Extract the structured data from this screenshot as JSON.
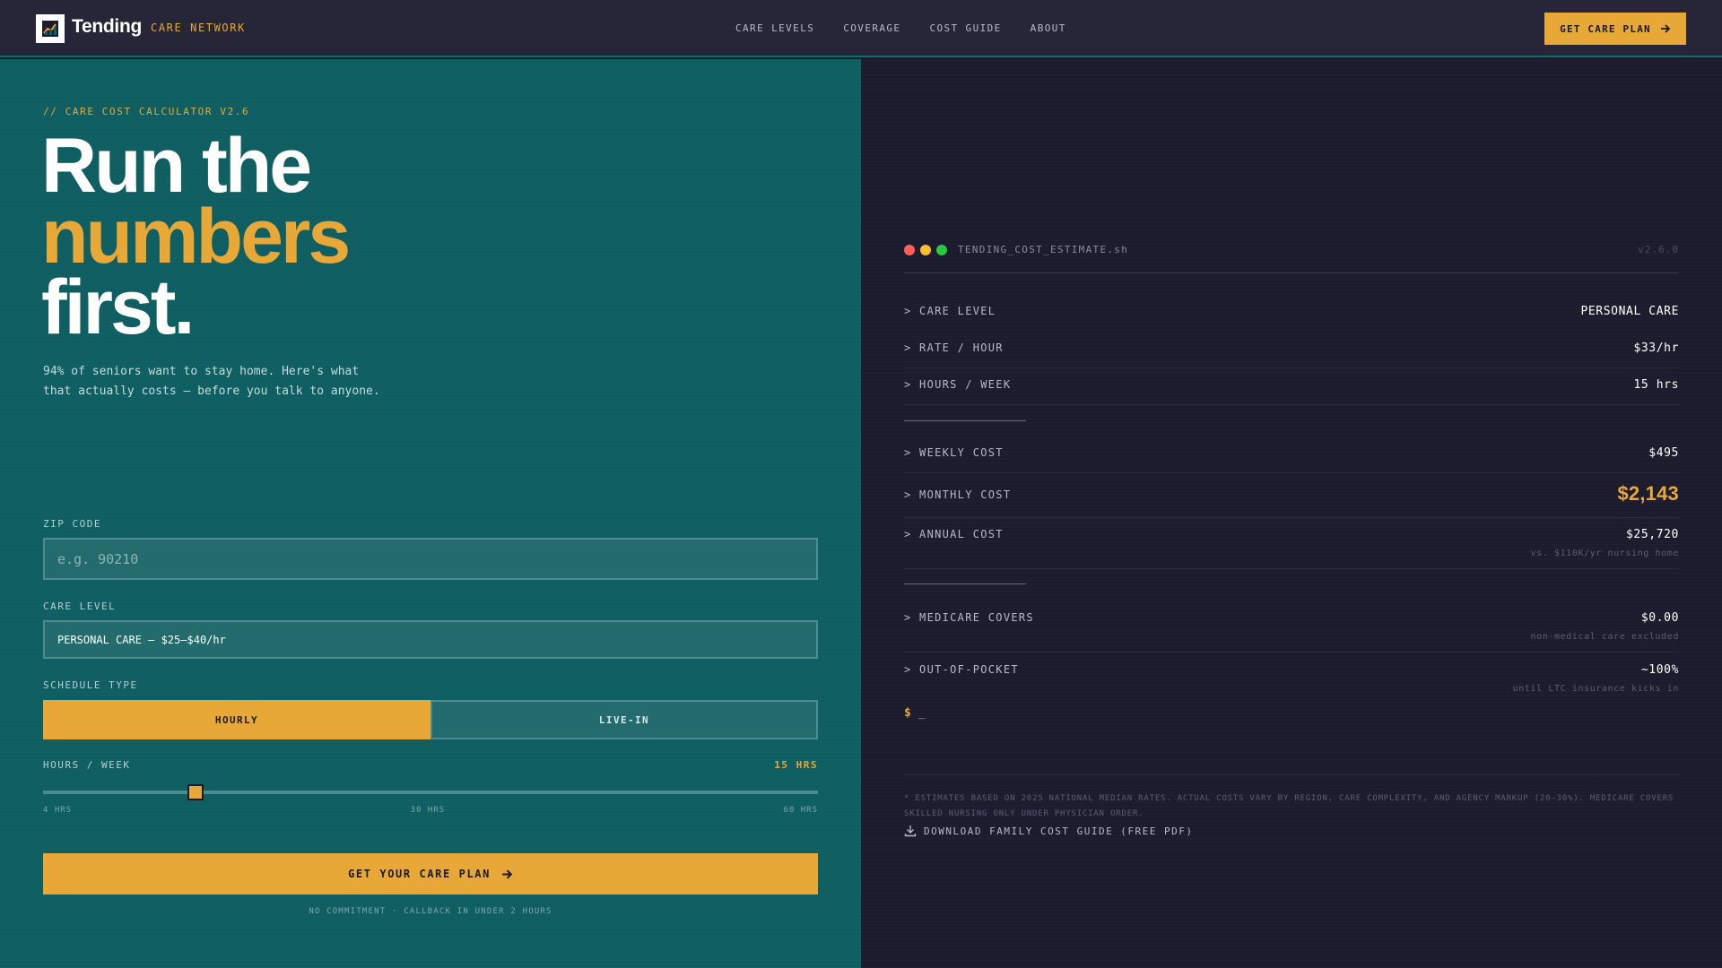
{
  "header": {
    "brand": "Tending",
    "brand_sub": "CARE NETWORK",
    "nav": [
      "CARE LEVELS",
      "COVERAGE",
      "COST GUIDE",
      "ABOUT"
    ],
    "cta": "GET CARE PLAN"
  },
  "hero": {
    "eyebrow": "// CARE COST CALCULATOR V2.6",
    "headline_1": "Run the",
    "headline_2": "numbers",
    "headline_3": "first.",
    "lede": "94% of seniors want to stay home. Here's what that actually costs — before you talk to anyone."
  },
  "form": {
    "zip_label": "ZIP CODE",
    "zip_placeholder": "e.g. 90210",
    "zip_value": "",
    "care_label": "CARE LEVEL",
    "care_value": "PERSONAL CARE — $25–$40/hr",
    "schedule_label": "SCHEDULE TYPE",
    "schedule_options": [
      "HOURLY",
      "LIVE-IN"
    ],
    "schedule_selected": "HOURLY",
    "hours_label": "HOURS / WEEK",
    "hours_value_text": "15 HRS",
    "hours_min": 4,
    "hours_max": 60,
    "hours_value": 15,
    "ticks": [
      "4 HRS",
      "30 HRS",
      "60 HRS"
    ],
    "submit": "GET YOUR CARE PLAN",
    "fine_print": "NO COMMITMENT · CALLBACK IN UNDER 2 HOURS"
  },
  "terminal": {
    "title": "TENDING_COST_ESTIMATE.sh",
    "version": "v2.6.0",
    "rows": {
      "care_level": {
        "k": "> CARE LEVEL",
        "v": "PERSONAL CARE"
      },
      "rate": {
        "k": "> RATE / HOUR",
        "v": "$33/hr"
      },
      "hours": {
        "k": "> HOURS / WEEK",
        "v": "15 hrs"
      },
      "weekly": {
        "k": "> WEEKLY COST",
        "v": "$495"
      },
      "monthly": {
        "k": "> MONTHLY COST",
        "v": "$2,143"
      },
      "annual": {
        "k": "> ANNUAL COST",
        "v": "$25,720",
        "note": "vs. $110K/yr nursing home"
      },
      "medicare": {
        "k": "> MEDICARE COVERS",
        "v": "$0.00",
        "note": "non-medical care excluded"
      },
      "oop": {
        "k": "> OUT-OF-POCKET",
        "v": "~100%",
        "note": "until LTC insurance kicks in"
      }
    },
    "prompt_symbol": "$",
    "cursor": "_",
    "disclaimer": "* ESTIMATES BASED ON 2025 NATIONAL MEDIAN RATES. ACTUAL COSTS VARY BY REGION, CARE COMPLEXITY, AND AGENCY MARKUP (20–30%). MEDICARE COVERS SKILLED NURSING ONLY UNDER PHYSICIAN ORDER.",
    "download": "DOWNLOAD FAMILY COST GUIDE (FREE PDF)"
  },
  "colors": {
    "accent": "#e8a838",
    "teal": "#0f5e62",
    "dark": "#1c1c2e",
    "dot_red": "#ff5f57",
    "dot_yellow": "#febc2e",
    "dot_green": "#28c840"
  }
}
